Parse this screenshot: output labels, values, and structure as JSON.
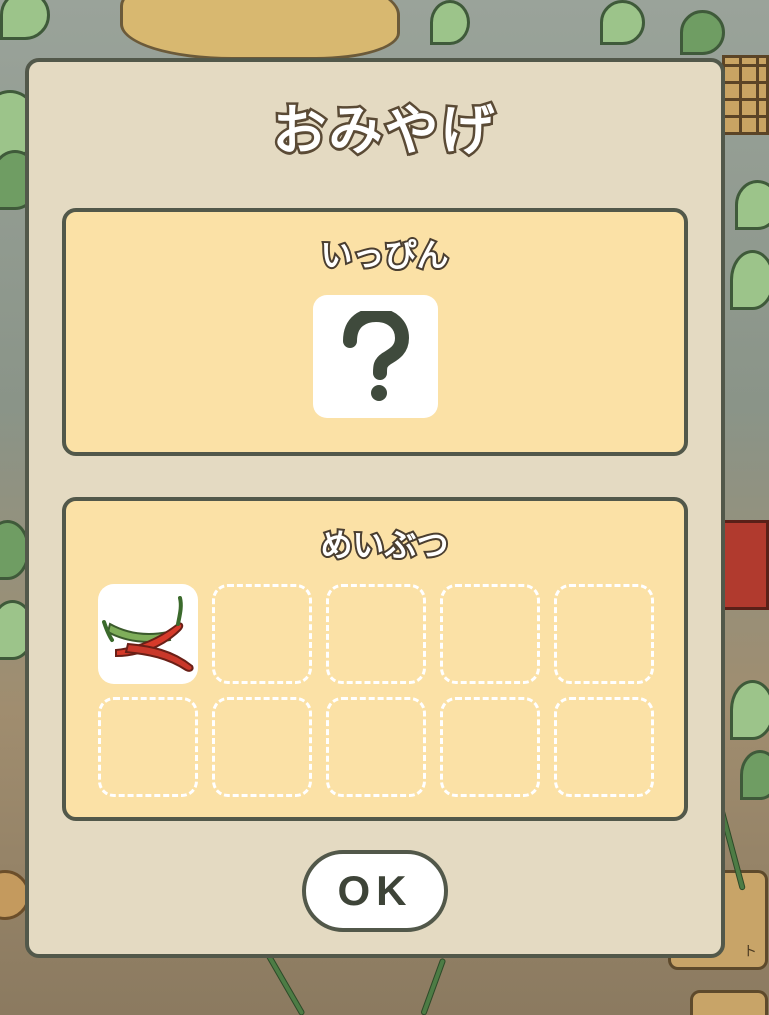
{
  "dialog": {
    "title": "おみやげ",
    "special": {
      "label": "いっぴん",
      "item_icon": "question-mark-icon",
      "item_glyph": "?"
    },
    "meibutsu": {
      "label": "めいぶつ",
      "slots": [
        {
          "filled": true,
          "item_icon": "red-chili-peppers-icon"
        },
        {
          "filled": false
        },
        {
          "filled": false
        },
        {
          "filled": false
        },
        {
          "filled": false
        },
        {
          "filled": false
        },
        {
          "filled": false
        },
        {
          "filled": false
        },
        {
          "filled": false
        },
        {
          "filled": false
        }
      ]
    },
    "ok_label": "OK"
  },
  "background": {
    "side_button_label": "ト"
  },
  "colors": {
    "dialog_bg": "#e4dac2",
    "panel_bg": "#fbe1a6",
    "outline": "#52584a",
    "title_stroke": "#5a4a35"
  }
}
